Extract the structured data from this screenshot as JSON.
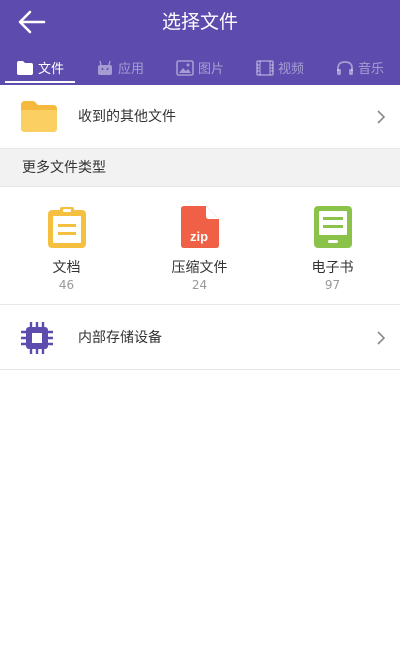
{
  "header": {
    "title": "选择文件"
  },
  "tabs": [
    {
      "label": "文件",
      "icon": "folder-icon",
      "active": true
    },
    {
      "label": "应用",
      "icon": "app-icon",
      "active": false
    },
    {
      "label": "图片",
      "icon": "image-icon",
      "active": false
    },
    {
      "label": "视频",
      "icon": "video-icon",
      "active": false
    },
    {
      "label": "音乐",
      "icon": "headphones-icon",
      "active": false
    }
  ],
  "received": {
    "label": "收到的其他文件",
    "icon": "folder-icon"
  },
  "more_types": {
    "title": "更多文件类型",
    "items": [
      {
        "name": "文档",
        "count": "46",
        "icon": "document-icon"
      },
      {
        "name": "压缩文件",
        "count": "24",
        "icon": "zip-icon",
        "icon_text": "zip"
      },
      {
        "name": "电子书",
        "count": "97",
        "icon": "ebook-icon"
      }
    ]
  },
  "storage": {
    "label": "内部存储设备",
    "icon": "chip-icon"
  },
  "colors": {
    "primary": "#5d4cae",
    "folder": "#f9c74f",
    "doc": "#f5c040",
    "zip": "#ef6046",
    "ebook": "#8bc34a",
    "chip": "#5d4cae"
  }
}
